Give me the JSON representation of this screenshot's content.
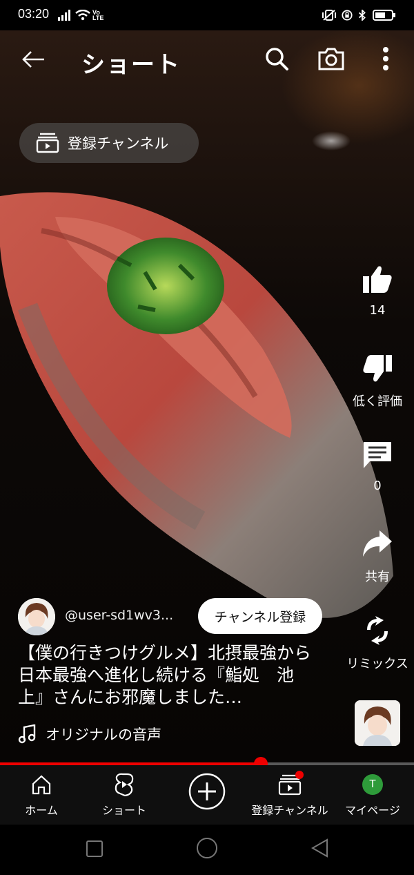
{
  "status_bar": {
    "time": "03:20",
    "network": "Vo LTE"
  },
  "header": {
    "title": "ショート"
  },
  "subscriptions_pill": {
    "label": "登録チャンネル"
  },
  "actions": {
    "like_count": "14",
    "dislike_label": "低く評価",
    "comment_count": "0",
    "share_label": "共有",
    "remix_label": "リミックス"
  },
  "channel": {
    "name": "@user-sd1wv3...",
    "subscribe_label": "チャンネル登録"
  },
  "video": {
    "title": "【僕の行きつけグルメ】北摂最強から日本最強へ進化し続ける『鮨処　池上』さんにお邪魔しました…",
    "sound": "オリジナルの音声",
    "progress_fraction": 0.63
  },
  "bottom_nav": {
    "items": [
      {
        "label": "ホーム"
      },
      {
        "label": "ショート"
      },
      {
        "label": ""
      },
      {
        "label": "登録チャンネル"
      },
      {
        "label": "マイページ"
      }
    ],
    "account_initial": "T"
  },
  "colors": {
    "accent": "#e00000",
    "account": "#2e9b3a"
  }
}
